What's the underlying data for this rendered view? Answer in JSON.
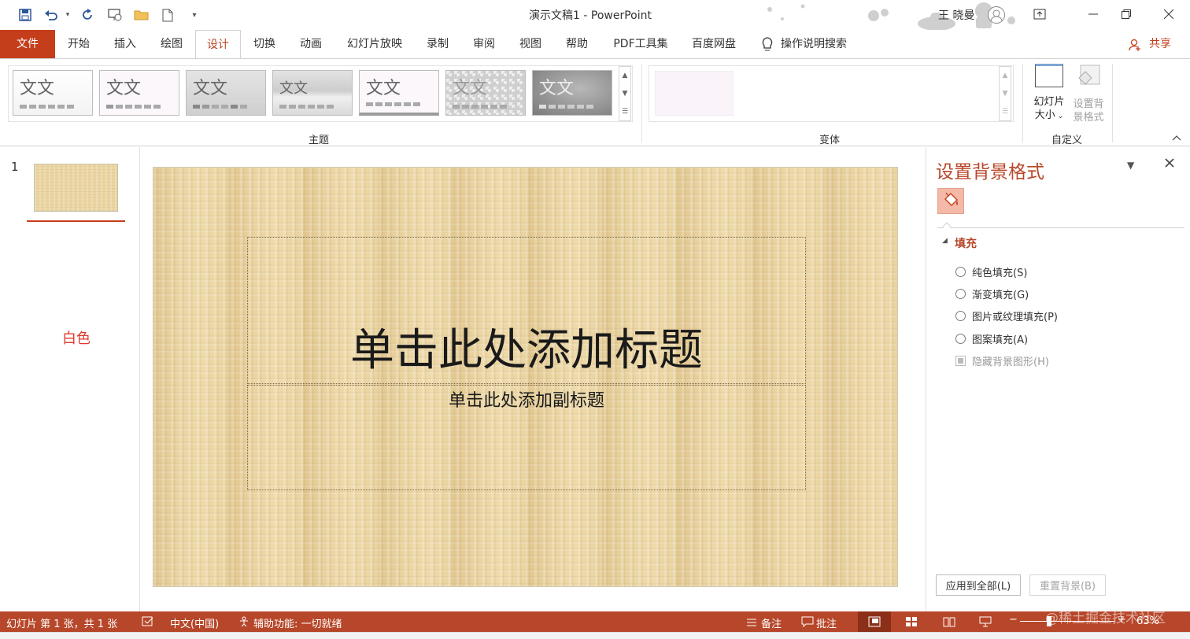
{
  "window": {
    "title": "演示文稿1  -  PowerPoint",
    "user": "王 晓曼"
  },
  "tabs": [
    {
      "label": "文件"
    },
    {
      "label": "开始"
    },
    {
      "label": "插入"
    },
    {
      "label": "绘图"
    },
    {
      "label": "设计"
    },
    {
      "label": "切换"
    },
    {
      "label": "动画"
    },
    {
      "label": "幻灯片放映"
    },
    {
      "label": "录制"
    },
    {
      "label": "审阅"
    },
    {
      "label": "视图"
    },
    {
      "label": "帮助"
    },
    {
      "label": "PDF工具集"
    },
    {
      "label": "百度网盘"
    }
  ],
  "tell_me": "操作说明搜索",
  "share": "共享",
  "ribbon": {
    "themes_group_label": "主题",
    "theme_sample_text": "文文",
    "variants_group_label": "变体",
    "customize_group_label": "自定义",
    "slide_size_label_1": "幻灯片",
    "slide_size_label_2": "大小",
    "format_bg_label_1": "设置背",
    "format_bg_label_2": "景格式"
  },
  "thumbnails": {
    "slide_number": "1",
    "annotation": "白色"
  },
  "slide": {
    "title_placeholder": "单击此处添加标题",
    "subtitle_placeholder": "单击此处添加副标题"
  },
  "format_panel": {
    "title": "设置背景格式",
    "section": "填充",
    "options": [
      {
        "label": "纯色填充(S)"
      },
      {
        "label": "渐变填充(G)"
      },
      {
        "label": "图片或纹理填充(P)"
      },
      {
        "label": "图案填充(A)"
      }
    ],
    "hide_bg_graphics": "隐藏背景图形(H)",
    "apply_all": "应用到全部(L)",
    "reset": "重置背景(B)"
  },
  "status": {
    "slide_info": "幻灯片 第 1 张，共 1 张",
    "language": "中文(中国)",
    "accessibility": "辅助功能: 一切就绪",
    "notes": "备注",
    "comments": "批注",
    "zoom": "63%",
    "watermark": "@稀土掘金技术社区"
  },
  "colors": {
    "accent": "#b7472a",
    "file_tab": "#c43e1c",
    "slide_bg": "#e9d3a0",
    "annotation": "#e03a2f"
  }
}
